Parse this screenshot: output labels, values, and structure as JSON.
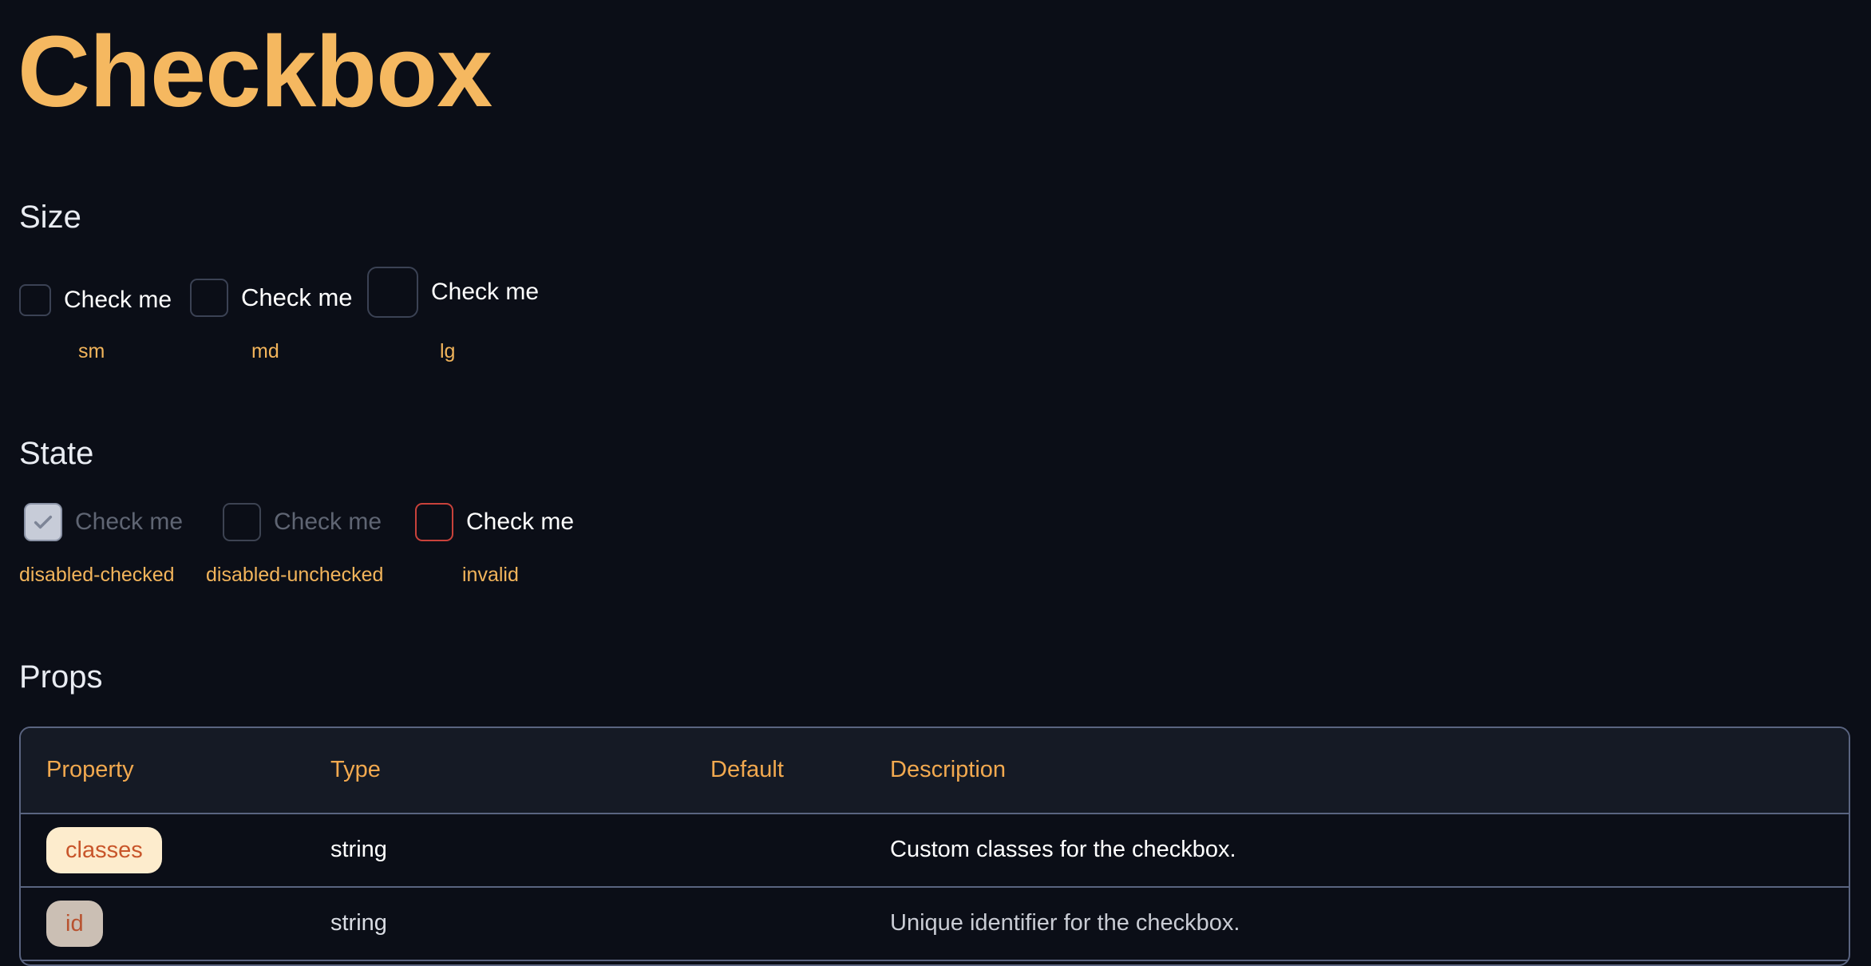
{
  "page": {
    "title": "Checkbox"
  },
  "size_section": {
    "title": "Size",
    "items": [
      {
        "label": "Check me",
        "caption": "sm"
      },
      {
        "label": "Check me",
        "caption": "md"
      },
      {
        "label": "Check me",
        "caption": "lg"
      }
    ]
  },
  "state_section": {
    "title": "State",
    "items": [
      {
        "label": "Check me",
        "caption": "disabled-checked"
      },
      {
        "label": "Check me",
        "caption": "disabled-unchecked"
      },
      {
        "label": "Check me",
        "caption": "invalid"
      }
    ]
  },
  "props_section": {
    "title": "Props",
    "headers": [
      "Property",
      "Type",
      "Default",
      "Description"
    ],
    "rows": [
      {
        "property": "classes",
        "type": "string",
        "default": "",
        "description": "Custom classes for the checkbox."
      },
      {
        "property": "id",
        "type": "string",
        "default": "",
        "description": "Unique identifier for the checkbox."
      }
    ]
  },
  "colors": {
    "background": "#0b0e17",
    "accent": "#f5b860",
    "invalid_border": "#c9423b",
    "disabled_checked_fill": "#c7ccd8"
  },
  "icons": {
    "check": "check-icon"
  }
}
